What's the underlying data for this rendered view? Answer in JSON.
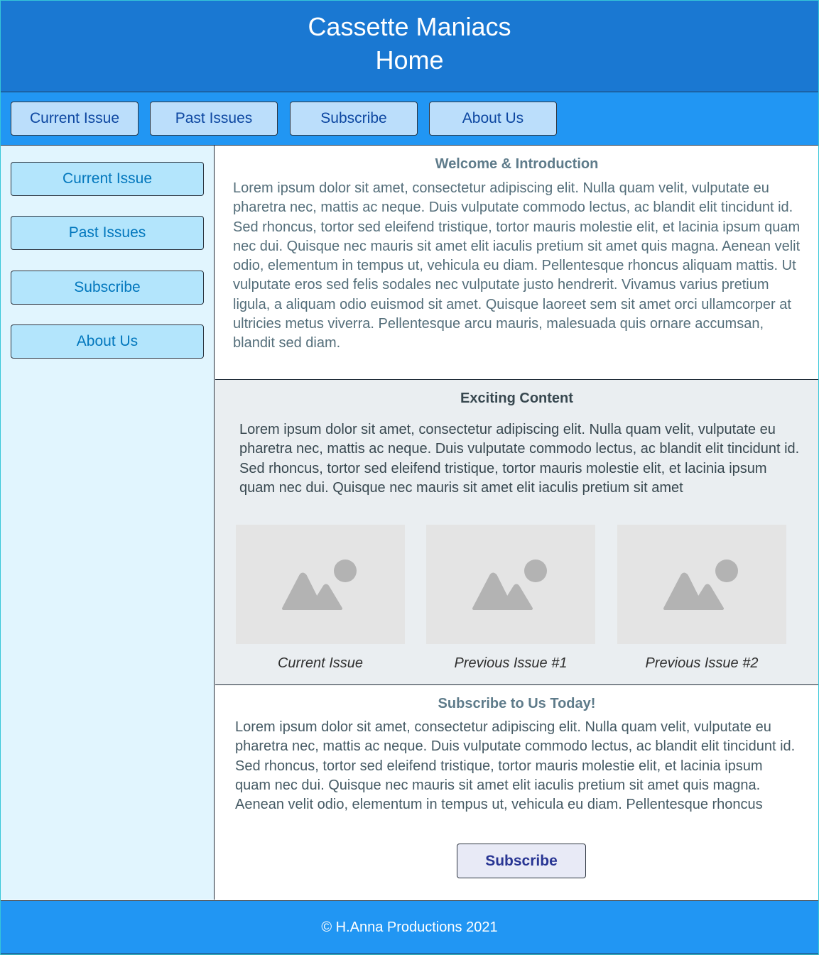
{
  "header": {
    "title_line1": "Cassette Maniacs",
    "title_line2": "Home"
  },
  "topnav": {
    "items": [
      {
        "label": "Current Issue"
      },
      {
        "label": "Past Issues"
      },
      {
        "label": "Subscribe"
      },
      {
        "label": "About Us"
      }
    ]
  },
  "sidebar": {
    "items": [
      {
        "label": "Current Issue"
      },
      {
        "label": "Past Issues"
      },
      {
        "label": "Subscribe"
      },
      {
        "label": "About Us"
      }
    ]
  },
  "welcome": {
    "title": "Welcome & Introduction",
    "body": "Lorem ipsum dolor sit amet, consectetur adipiscing elit. Nulla quam velit, vulputate eu pharetra nec, mattis ac neque. Duis vulputate commodo lectus, ac blandit elit tincidunt id. Sed rhoncus, tortor sed eleifend tristique, tortor mauris molestie elit, et lacinia ipsum quam nec dui. Quisque nec mauris sit amet elit iaculis pretium sit amet quis magna. Aenean velit odio, elementum in tempus ut, vehicula eu diam. Pellentesque rhoncus aliquam mattis. Ut vulputate eros sed felis sodales nec vulputate justo hendrerit. Vivamus varius pretium ligula, a aliquam odio euismod sit amet. Quisque laoreet sem sit amet orci ullamcorper at ultricies metus viverra. Pellentesque arcu mauris, malesuada quis ornare accumsan, blandit sed diam."
  },
  "exciting": {
    "title": "Exciting Content",
    "body": "Lorem ipsum dolor sit amet, consectetur adipiscing elit. Nulla quam velit, vulputate eu pharetra nec, mattis ac neque. Duis vulputate commodo lectus, ac blandit elit tincidunt id. Sed rhoncus, tortor sed eleifend tristique, tortor mauris molestie elit, et lacinia ipsum quam nec dui. Quisque nec mauris sit amet elit iaculis pretium sit amet",
    "images": [
      {
        "icon": "image-placeholder-icon",
        "caption": "Current Issue"
      },
      {
        "icon": "image-placeholder-icon",
        "caption": "Previous Issue #1"
      },
      {
        "icon": "image-placeholder-icon",
        "caption": "Previous Issue #2"
      }
    ]
  },
  "subscribe": {
    "title": "Subscribe to Us Today!",
    "body": "Lorem ipsum dolor sit amet, consectetur adipiscing elit. Nulla quam velit, vulputate eu pharetra nec, mattis ac neque. Duis vulputate commodo lectus, ac blandit elit tincidunt id. Sed rhoncus, tortor sed eleifend tristique, tortor mauris molestie elit, et lacinia ipsum quam nec dui. Quisque nec mauris sit amet elit iaculis pretium sit amet quis magna. Aenean velit odio, elementum in tempus ut, vehicula eu diam. Pellentesque rhoncus aliquam mattis. Ut vulputate eros sed felis sodales nec",
    "button_label": "Subscribe"
  },
  "footer": {
    "text": "© H.Anna Productions 2021"
  },
  "colors": {
    "header_bg": "#1a78d2",
    "nav_bg": "#2196f3",
    "nav_button_bg": "#bbdefb",
    "sidebar_bg": "#e1f5fe",
    "sidebar_button_bg": "#b3e5fc",
    "exciting_bg": "#eaeef1",
    "subscribe_button_bg": "#e8eaf6"
  }
}
